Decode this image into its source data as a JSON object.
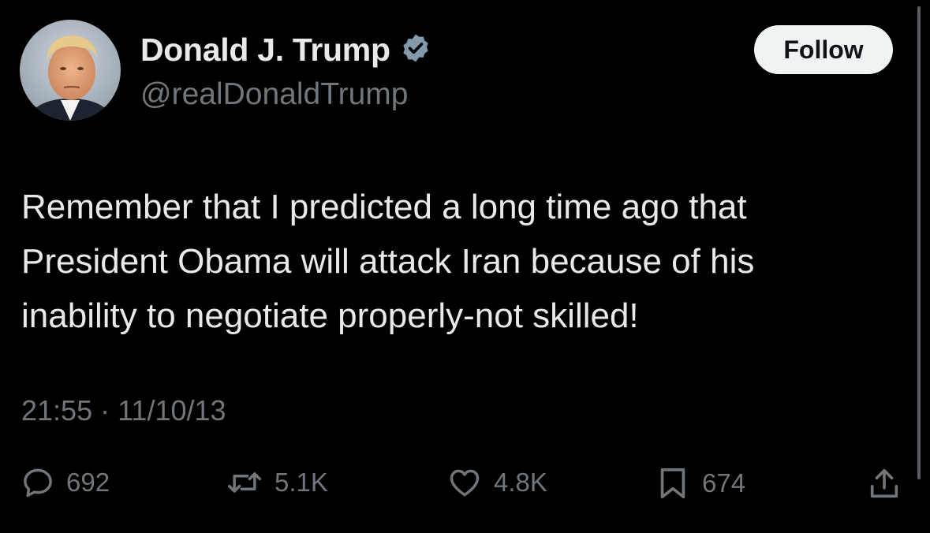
{
  "author": {
    "display_name": "Donald J. Trump",
    "handle": "@realDonaldTrump",
    "verified_icon": "verified-badge-icon",
    "avatar": "profile-photo"
  },
  "follow_button": {
    "label": "Follow"
  },
  "tweet": {
    "text": "Remember that I predicted a long time ago that\nPresident Obama will attack Iran because of his\ninability to negotiate properly-not skilled!",
    "timestamp": "21:55 · 11/10/13"
  },
  "metrics": {
    "replies": "692",
    "reposts": "5.1K",
    "likes": "4.8K",
    "bookmarks": "674"
  },
  "icons": {
    "reply": "reply-icon",
    "repost": "repost-icon",
    "like": "heart-icon",
    "bookmark": "bookmark-icon",
    "share": "share-icon"
  },
  "colors": {
    "background": "#000000",
    "text_primary": "#e7e9ea",
    "text_secondary": "#71767b",
    "verified": "#829aab",
    "button_bg": "#eff3f4"
  }
}
